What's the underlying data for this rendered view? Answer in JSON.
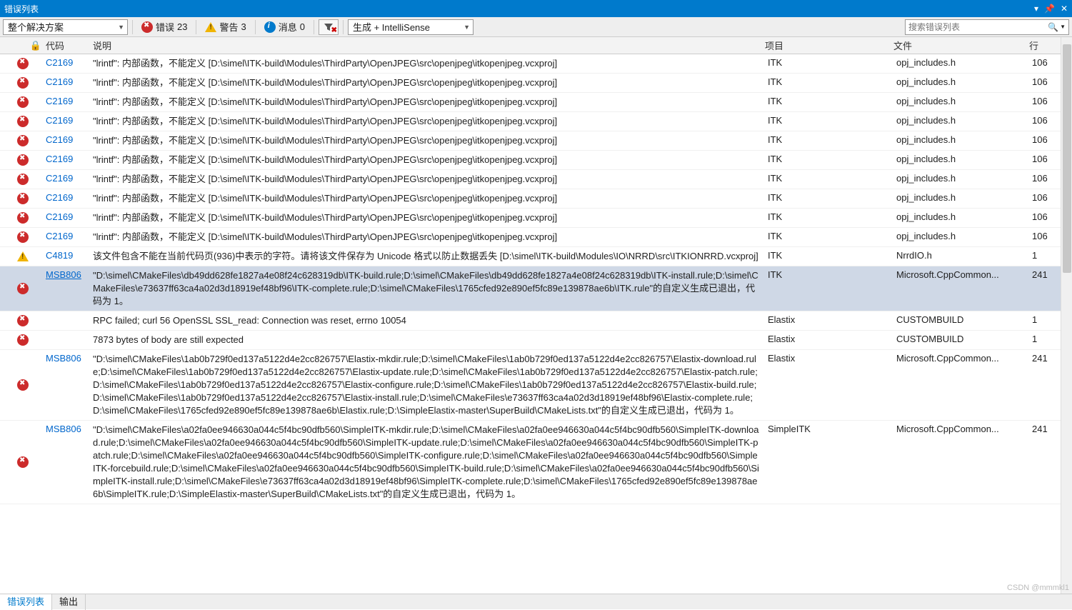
{
  "window": {
    "title": "错误列表"
  },
  "toolbar": {
    "scope": "整个解决方案",
    "errors_label": "错误",
    "errors_count": "23",
    "warnings_label": "警告",
    "warnings_count": "3",
    "messages_label": "消息",
    "messages_count": "0",
    "build_mode": "生成 + IntelliSense",
    "search_placeholder": "搜索错误列表"
  },
  "columns": {
    "code": "代码",
    "desc": "说明",
    "project": "项目",
    "file": "文件",
    "line": "行"
  },
  "watermark": "CSDN @mmmkl1",
  "tabs": {
    "error_list": "错误列表",
    "output": "输出"
  },
  "rows": [
    {
      "sev": "error",
      "code": "C2169",
      "desc": "\"lrintf\": 内部函数，不能定义 [D:\\simel\\ITK-build\\Modules\\ThirdParty\\OpenJPEG\\src\\openjpeg\\itkopenjpeg.vcxproj]",
      "project": "ITK",
      "file": "opj_includes.h",
      "line": "106"
    },
    {
      "sev": "error",
      "code": "C2169",
      "desc": "\"lrintf\": 内部函数，不能定义 [D:\\simel\\ITK-build\\Modules\\ThirdParty\\OpenJPEG\\src\\openjpeg\\itkopenjpeg.vcxproj]",
      "project": "ITK",
      "file": "opj_includes.h",
      "line": "106"
    },
    {
      "sev": "error",
      "code": "C2169",
      "desc": "\"lrintf\": 内部函数，不能定义 [D:\\simel\\ITK-build\\Modules\\ThirdParty\\OpenJPEG\\src\\openjpeg\\itkopenjpeg.vcxproj]",
      "project": "ITK",
      "file": "opj_includes.h",
      "line": "106"
    },
    {
      "sev": "error",
      "code": "C2169",
      "desc": "\"lrintf\": 内部函数，不能定义 [D:\\simel\\ITK-build\\Modules\\ThirdParty\\OpenJPEG\\src\\openjpeg\\itkopenjpeg.vcxproj]",
      "project": "ITK",
      "file": "opj_includes.h",
      "line": "106"
    },
    {
      "sev": "error",
      "code": "C2169",
      "desc": "\"lrintf\": 内部函数，不能定义 [D:\\simel\\ITK-build\\Modules\\ThirdParty\\OpenJPEG\\src\\openjpeg\\itkopenjpeg.vcxproj]",
      "project": "ITK",
      "file": "opj_includes.h",
      "line": "106"
    },
    {
      "sev": "error",
      "code": "C2169",
      "desc": "\"lrintf\": 内部函数，不能定义 [D:\\simel\\ITK-build\\Modules\\ThirdParty\\OpenJPEG\\src\\openjpeg\\itkopenjpeg.vcxproj]",
      "project": "ITK",
      "file": "opj_includes.h",
      "line": "106"
    },
    {
      "sev": "error",
      "code": "C2169",
      "desc": "\"lrintf\": 内部函数，不能定义 [D:\\simel\\ITK-build\\Modules\\ThirdParty\\OpenJPEG\\src\\openjpeg\\itkopenjpeg.vcxproj]",
      "project": "ITK",
      "file": "opj_includes.h",
      "line": "106"
    },
    {
      "sev": "error",
      "code": "C2169",
      "desc": "\"lrintf\": 内部函数，不能定义 [D:\\simel\\ITK-build\\Modules\\ThirdParty\\OpenJPEG\\src\\openjpeg\\itkopenjpeg.vcxproj]",
      "project": "ITK",
      "file": "opj_includes.h",
      "line": "106"
    },
    {
      "sev": "error",
      "code": "C2169",
      "desc": "\"lrintf\": 内部函数，不能定义 [D:\\simel\\ITK-build\\Modules\\ThirdParty\\OpenJPEG\\src\\openjpeg\\itkopenjpeg.vcxproj]",
      "project": "ITK",
      "file": "opj_includes.h",
      "line": "106"
    },
    {
      "sev": "error",
      "code": "C2169",
      "desc": "\"lrintf\": 内部函数，不能定义 [D:\\simel\\ITK-build\\Modules\\ThirdParty\\OpenJPEG\\src\\openjpeg\\itkopenjpeg.vcxproj]",
      "project": "ITK",
      "file": "opj_includes.h",
      "line": "106"
    },
    {
      "sev": "warning",
      "code": "C4819",
      "desc": "该文件包含不能在当前代码页(936)中表示的字符。请将该文件保存为 Unicode 格式以防止数据丢失 [D:\\simel\\ITK-build\\Modules\\IO\\NRRD\\src\\ITKIONRRD.vcxproj]",
      "project": "ITK",
      "file": "NrrdIO.h",
      "line": "1"
    },
    {
      "sev": "error",
      "code": "MSB806",
      "selected": true,
      "desc": "\"D:\\simel\\CMakeFiles\\db49dd628fe1827a4e08f24c628319db\\ITK-build.rule;D:\\simel\\CMakeFiles\\db49dd628fe1827a4e08f24c628319db\\ITK-install.rule;D:\\simel\\CMakeFiles\\e73637ff63ca4a02d3d18919ef48bf96\\ITK-complete.rule;D:\\simel\\CMakeFiles\\1765cfed92e890ef5fc89e139878ae6b\\ITK.rule\"的自定义生成已退出，代码为 1。",
      "project": "ITK",
      "file": "Microsoft.CppCommon...",
      "line": "241"
    },
    {
      "sev": "error",
      "code": "",
      "desc": "RPC failed; curl 56 OpenSSL SSL_read: Connection was reset, errno 10054",
      "project": "Elastix",
      "file": "CUSTOMBUILD",
      "line": "1"
    },
    {
      "sev": "error",
      "code": "",
      "desc": "7873 bytes of body are still expected",
      "project": "Elastix",
      "file": "CUSTOMBUILD",
      "line": "1"
    },
    {
      "sev": "error",
      "code": "MSB806",
      "desc": "\"D:\\simel\\CMakeFiles\\1ab0b729f0ed137a5122d4e2cc826757\\Elastix-mkdir.rule;D:\\simel\\CMakeFiles\\1ab0b729f0ed137a5122d4e2cc826757\\Elastix-download.rule;D:\\simel\\CMakeFiles\\1ab0b729f0ed137a5122d4e2cc826757\\Elastix-update.rule;D:\\simel\\CMakeFiles\\1ab0b729f0ed137a5122d4e2cc826757\\Elastix-patch.rule;D:\\simel\\CMakeFiles\\1ab0b729f0ed137a5122d4e2cc826757\\Elastix-configure.rule;D:\\simel\\CMakeFiles\\1ab0b729f0ed137a5122d4e2cc826757\\Elastix-build.rule;D:\\simel\\CMakeFiles\\1ab0b729f0ed137a5122d4e2cc826757\\Elastix-install.rule;D:\\simel\\CMakeFiles\\e73637ff63ca4a02d3d18919ef48bf96\\Elastix-complete.rule;D:\\simel\\CMakeFiles\\1765cfed92e890ef5fc89e139878ae6b\\Elastix.rule;D:\\SimpleElastix-master\\SuperBuild\\CMakeLists.txt\"的自定义生成已退出，代码为 1。",
      "project": "Elastix",
      "file": "Microsoft.CppCommon...",
      "line": "241"
    },
    {
      "sev": "error",
      "code": "MSB806",
      "desc": "\"D:\\simel\\CMakeFiles\\a02fa0ee946630a044c5f4bc90dfb560\\SimpleITK-mkdir.rule;D:\\simel\\CMakeFiles\\a02fa0ee946630a044c5f4bc90dfb560\\SimpleITK-download.rule;D:\\simel\\CMakeFiles\\a02fa0ee946630a044c5f4bc90dfb560\\SimpleITK-update.rule;D:\\simel\\CMakeFiles\\a02fa0ee946630a044c5f4bc90dfb560\\SimpleITK-patch.rule;D:\\simel\\CMakeFiles\\a02fa0ee946630a044c5f4bc90dfb560\\SimpleITK-configure.rule;D:\\simel\\CMakeFiles\\a02fa0ee946630a044c5f4bc90dfb560\\SimpleITK-forcebuild.rule;D:\\simel\\CMakeFiles\\a02fa0ee946630a044c5f4bc90dfb560\\SimpleITK-build.rule;D:\\simel\\CMakeFiles\\a02fa0ee946630a044c5f4bc90dfb560\\SimpleITK-install.rule;D:\\simel\\CMakeFiles\\e73637ff63ca4a02d3d18919ef48bf96\\SimpleITK-complete.rule;D:\\simel\\CMakeFiles\\1765cfed92e890ef5fc89e139878ae6b\\SimpleITK.rule;D:\\SimpleElastix-master\\SuperBuild\\CMakeLists.txt\"的自定义生成已退出，代码为 1。",
      "project": "SimpleITK",
      "file": "Microsoft.CppCommon...",
      "line": "241"
    }
  ]
}
